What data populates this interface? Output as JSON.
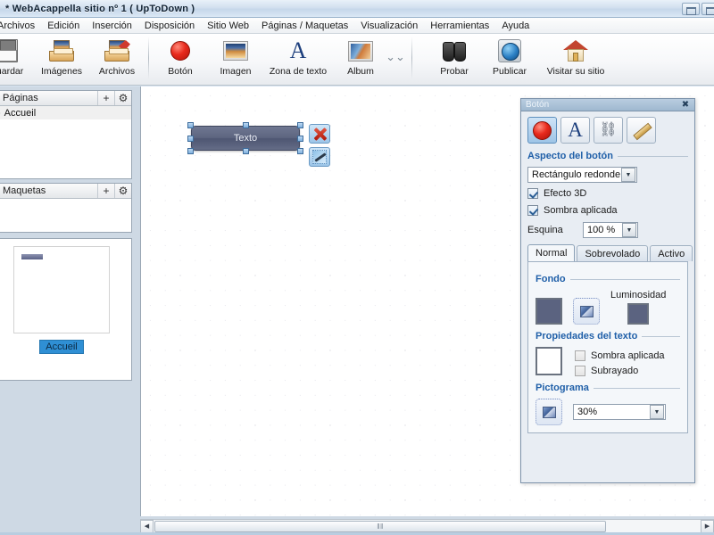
{
  "window": {
    "title": "* WebAcappella sitio nº 1 ( UpToDown )",
    "controls": [
      "minimize",
      "maximize"
    ]
  },
  "menubar": {
    "items": [
      {
        "label": "Archivos",
        "name": "menu-archivos"
      },
      {
        "label": "Edición",
        "name": "menu-edicion"
      },
      {
        "label": "Inserción",
        "name": "menu-insercion"
      },
      {
        "label": "Disposición",
        "name": "menu-disposicion"
      },
      {
        "label": "Sitio Web",
        "name": "menu-sitio-web"
      },
      {
        "label": "Páginas / Maquetas",
        "name": "menu-paginas-maquetas"
      },
      {
        "label": "Visualización",
        "name": "menu-visualizacion"
      },
      {
        "label": "Herramientas",
        "name": "menu-herramientas"
      },
      {
        "label": "Ayuda",
        "name": "menu-ayuda"
      }
    ]
  },
  "toolbar": {
    "group1": [
      {
        "label": "Guardar",
        "icon": "floppy-disk-icon"
      },
      {
        "label": "Imágenes",
        "icon": "images-tray-icon"
      },
      {
        "label": "Archivos",
        "icon": "files-tray-icon"
      }
    ],
    "group2": [
      {
        "label": "Botón",
        "icon": "red-circle-icon"
      },
      {
        "label": "Imagen",
        "icon": "picture-icon"
      },
      {
        "label": "Zona de texto",
        "icon": "letter-a-icon"
      },
      {
        "label": "Album",
        "icon": "album-icon"
      }
    ],
    "overflow": "chevron-double-down-icon",
    "group3": [
      {
        "label": "Probar",
        "icon": "binoculars-icon"
      },
      {
        "label": "Publicar",
        "icon": "globe-icon"
      },
      {
        "label": "Visitar su sitio",
        "icon": "home-icon"
      }
    ]
  },
  "sidebar": {
    "pages_panel": {
      "title": "Páginas",
      "add_label": "+",
      "settings_label": "⚙",
      "items": [
        {
          "label": "Accueil"
        }
      ]
    },
    "layouts_panel": {
      "title": "Maquetas",
      "add_label": "+",
      "settings_label": "⚙",
      "items": []
    },
    "preview_panel": {
      "thumbnail_label": "Accueil"
    }
  },
  "canvas": {
    "widget": {
      "type": "button",
      "text": "Texto",
      "selected": true,
      "actions": [
        {
          "name": "delete-widget-button",
          "icon": "red-x-icon"
        },
        {
          "name": "edit-widget-button",
          "icon": "wrench-icon"
        }
      ]
    },
    "hscrollbar": {
      "left_arrow": "◀",
      "right_arrow": "▶",
      "grip": "‖‖"
    }
  },
  "properties": {
    "title": "Botón",
    "close_label": "✖",
    "icon_tabs": [
      {
        "name": "appearance-tab",
        "icon": "red-circle-icon",
        "selected": true
      },
      {
        "name": "text-tab",
        "icon": "letter-a-icon",
        "selected": false
      },
      {
        "name": "link-tab",
        "icon": "chain-link-icon",
        "selected": false
      },
      {
        "name": "style-tab",
        "icon": "pencil-icon",
        "selected": false
      }
    ],
    "appearance": {
      "section_title": "Aspecto del botón",
      "shape_value": "Rectángulo redondeado",
      "effect3d": {
        "label": "Efecto 3D",
        "checked": true
      },
      "shadow": {
        "label": "Sombra aplicada",
        "checked": true
      },
      "corner": {
        "label": "Esquina",
        "value": "100 %"
      }
    },
    "state_tabs": [
      {
        "label": "Normal",
        "active": true
      },
      {
        "label": "Sobrevolado",
        "active": false
      },
      {
        "label": "Activo",
        "active": false
      }
    ],
    "background": {
      "section_title": "Fondo",
      "color": "#5b6380",
      "pattern_icon": "pattern-picker-icon",
      "luminosity_label": "Luminosidad",
      "luminosity_color": "#5b6380"
    },
    "text_properties": {
      "section_title": "Propiedades del texto",
      "color": "#ffffff",
      "shadow": {
        "label": "Sombra aplicada",
        "checked": false
      },
      "underline": {
        "label": "Subrayado",
        "checked": false
      }
    },
    "pictogram": {
      "section_title": "Pictograma",
      "picker_icon": "pictogram-picker-icon",
      "size_value": "30%"
    }
  }
}
